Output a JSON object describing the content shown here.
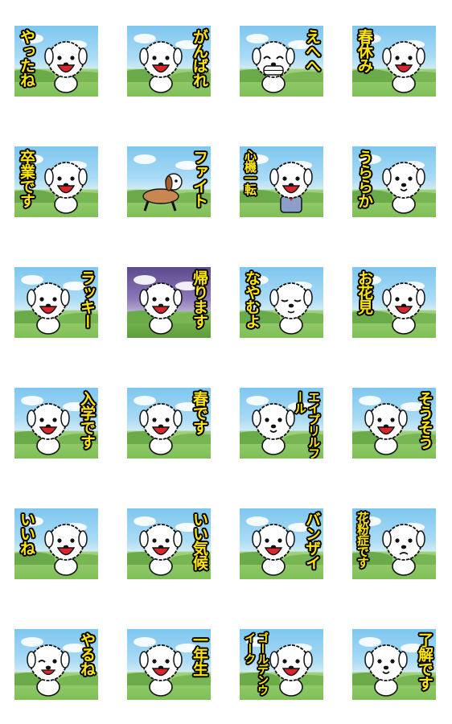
{
  "stickers": [
    {
      "text": "やったね",
      "side": "left",
      "mood": "happy"
    },
    {
      "text": "がんばれ",
      "side": "right",
      "mood": "happy"
    },
    {
      "text": "えへへ",
      "side": "right",
      "mood": "grin"
    },
    {
      "text": "春休み",
      "side": "left",
      "mood": "happy"
    },
    {
      "text": "卒業です",
      "side": "left",
      "mood": "happy"
    },
    {
      "text": "ファイト",
      "side": "right",
      "mood": "brown"
    },
    {
      "text": "心機一転",
      "side": "left",
      "mood": "suit",
      "size": "small"
    },
    {
      "text": "うららか",
      "side": "left",
      "mood": "calm"
    },
    {
      "text": "ラッキー",
      "side": "right",
      "mood": "happy"
    },
    {
      "text": "帰ります",
      "side": "right",
      "mood": "happy",
      "evening": true
    },
    {
      "text": "なやむよ",
      "side": "left",
      "mood": "sleepy"
    },
    {
      "text": "お花見",
      "side": "left",
      "mood": "happy"
    },
    {
      "text": "入学です",
      "side": "right",
      "mood": "happy"
    },
    {
      "text": "春です",
      "side": "right",
      "mood": "happy"
    },
    {
      "text": "エイプリルフール",
      "side": "right",
      "mood": "calm",
      "size": "small"
    },
    {
      "text": "そうそう",
      "side": "right",
      "mood": "happy"
    },
    {
      "text": "いいね",
      "side": "left",
      "mood": "happy"
    },
    {
      "text": "いい気候",
      "side": "right",
      "mood": "happy"
    },
    {
      "text": "バンザイ",
      "side": "right",
      "mood": "happy"
    },
    {
      "text": "花粉症です",
      "side": "left",
      "mood": "sad",
      "size": "small"
    },
    {
      "text": "やるね",
      "side": "right",
      "mood": "wink"
    },
    {
      "text": "一年生",
      "side": "right",
      "mood": "happy"
    },
    {
      "text": "ゴールデンウイーク",
      "side": "left",
      "mood": "happy",
      "size": "xsmall"
    },
    {
      "text": "了解です",
      "side": "right",
      "mood": "calm"
    }
  ]
}
